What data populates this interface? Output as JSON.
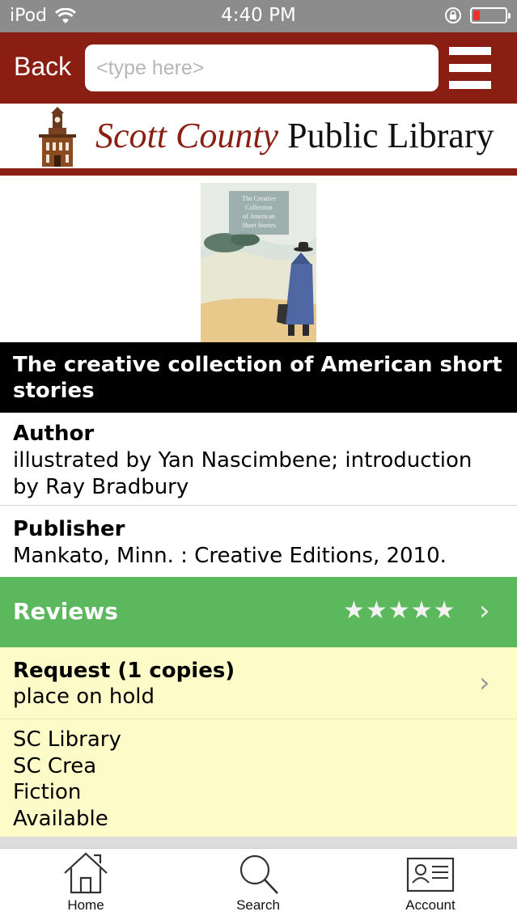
{
  "status_bar": {
    "carrier": "iPod",
    "time": "4:40 PM"
  },
  "topnav": {
    "back_label": "Back",
    "search_placeholder": "<type here>",
    "search_value": ""
  },
  "banner": {
    "name_part1": "Scott County",
    "name_part2": "Public Library"
  },
  "book": {
    "cover_text": "The Creative Collection of American Short Stories",
    "title": "The creative collection of American short stories",
    "author_label": "Author",
    "author_value": "illustrated by Yan Nascimbene; introduction by Ray Bradbury",
    "publisher_label": "Publisher",
    "publisher_value": "Mankato, Minn. : Creative Editions, 2010."
  },
  "reviews": {
    "label": "Reviews",
    "stars": "★★★★★",
    "rating_stars": 5
  },
  "request": {
    "label": "Request (1 copies)",
    "sub": "place on hold"
  },
  "holdings": {
    "lines": [
      "SC Library",
      "SC Crea",
      "Fiction",
      "Available"
    ]
  },
  "tabbar": {
    "home": "Home",
    "search": "Search",
    "account": "Account"
  },
  "colors": {
    "brand": "#8b1e12",
    "reviews_bg": "#5cb85c",
    "request_bg": "#fdfbc7"
  }
}
